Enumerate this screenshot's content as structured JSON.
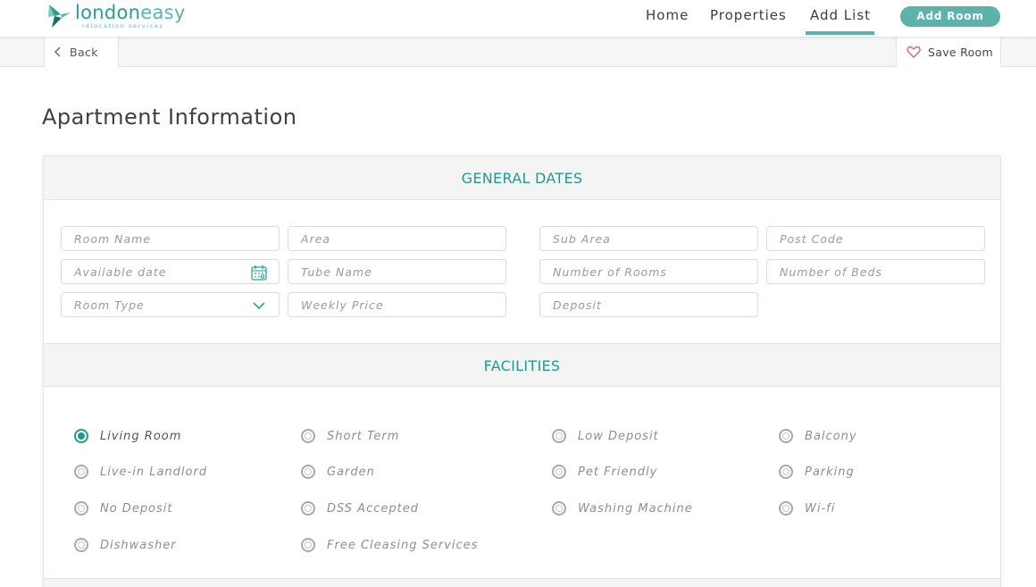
{
  "brand": {
    "name_part1": "london",
    "name_part2": "easy",
    "tagline": "relocation services",
    "accent": "#1f9a8c"
  },
  "nav": {
    "items": [
      {
        "label": "Home"
      },
      {
        "label": "Properties"
      },
      {
        "label": "Add List",
        "active": true
      }
    ],
    "cta_label": "Add Room"
  },
  "subbar": {
    "back_label": "Back",
    "save_label": "Save Room"
  },
  "page": {
    "title": "Apartment Information"
  },
  "general": {
    "heading": "GENERAL DATES",
    "fields": {
      "room_name": "Room Name",
      "area": "Area",
      "sub_area": "Sub Area",
      "post_code": "Post Code",
      "available_date": "Available date",
      "tube_name": "Tube Name",
      "number_of_rooms": "Number of Rooms",
      "number_of_beds": "Number of Beds",
      "room_type": "Room Type",
      "weekly_price": "Weekly Price",
      "deposit": "Deposit"
    }
  },
  "facilities": {
    "heading": "FACILITIES",
    "options": [
      {
        "label": "Living Room",
        "checked": true
      },
      {
        "label": "Short Term",
        "checked": false
      },
      {
        "label": "Low Deposit",
        "checked": false
      },
      {
        "label": "Balcony",
        "checked": false
      },
      {
        "label": "Live-in Landlord",
        "checked": false
      },
      {
        "label": "Garden",
        "checked": false
      },
      {
        "label": "Pet Friendly",
        "checked": false
      },
      {
        "label": "Parking",
        "checked": false
      },
      {
        "label": "No Deposit",
        "checked": false
      },
      {
        "label": "DSS Accepted",
        "checked": false
      },
      {
        "label": "Washing Machine",
        "checked": false
      },
      {
        "label": "Wi-fi",
        "checked": false
      },
      {
        "label": "Dishwasher",
        "checked": false
      },
      {
        "label": "Free Cleasing Services",
        "checked": false
      }
    ]
  }
}
